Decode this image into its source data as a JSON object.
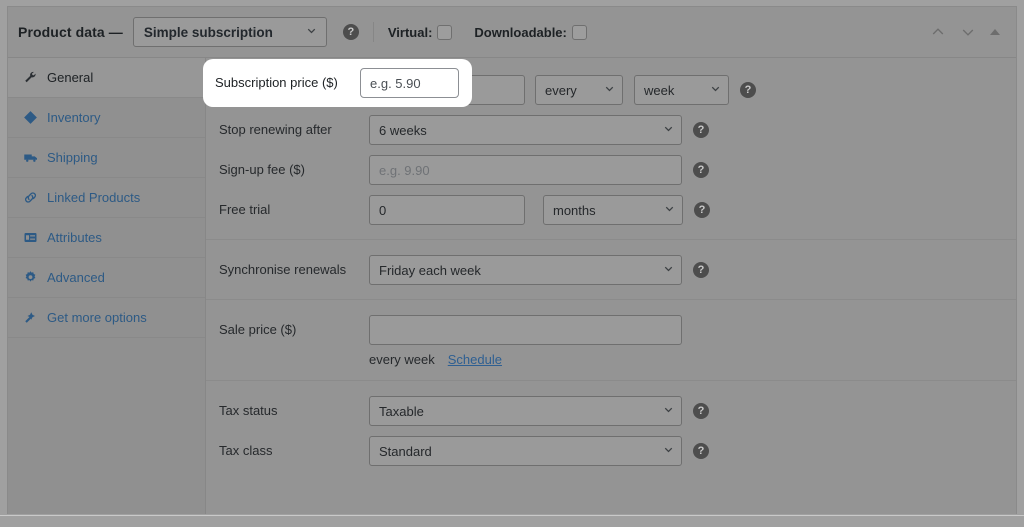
{
  "header": {
    "title": "Product data —",
    "product_type": "Simple subscription",
    "product_type_icon": "chevron-down-icon",
    "help_icon": "help-icon",
    "virtual_label": "Virtual:",
    "downloadable_label": "Downloadable:",
    "virtual_checked": false,
    "downloadable_checked": false,
    "move_up_icon": "chevron-up-icon",
    "move_down_icon": "chevron-down-icon",
    "collapse_icon": "triangle-up-icon"
  },
  "tabs": [
    {
      "label": "General",
      "icon": "wrench-icon",
      "active": true
    },
    {
      "label": "Inventory",
      "icon": "tag-icon",
      "active": false
    },
    {
      "label": "Shipping",
      "icon": "truck-icon",
      "active": false
    },
    {
      "label": "Linked Products",
      "icon": "link-icon",
      "active": false
    },
    {
      "label": "Attributes",
      "icon": "list-icon",
      "active": false
    },
    {
      "label": "Advanced",
      "icon": "gear-icon",
      "active": false
    },
    {
      "label": "Get more options",
      "icon": "star-icon",
      "active": false
    }
  ],
  "fields": {
    "subscription_price": {
      "label": "Subscription price ($)",
      "value": "",
      "placeholder": "e.g. 5.90",
      "interval": "every",
      "period": "week",
      "highlighted": true
    },
    "stop_renewing": {
      "label": "Stop renewing after",
      "value": "6 weeks"
    },
    "signup_fee": {
      "label": "Sign-up fee ($)",
      "value": "",
      "placeholder": "e.g. 9.90"
    },
    "free_trial": {
      "label": "Free trial",
      "value": "0",
      "period": "months"
    },
    "sync_renewals": {
      "label": "Synchronise renewals",
      "value": "Friday each week"
    },
    "sale_price": {
      "label": "Sale price ($)",
      "value": "",
      "placeholder": "",
      "note": "every week",
      "schedule_link": "Schedule"
    },
    "tax_status": {
      "label": "Tax status",
      "value": "Taxable"
    },
    "tax_class": {
      "label": "Tax class",
      "value": "Standard"
    }
  },
  "colors": {
    "link": "#2e5f92",
    "panel_bg": "#949494",
    "spotlight": "#ffffff"
  }
}
